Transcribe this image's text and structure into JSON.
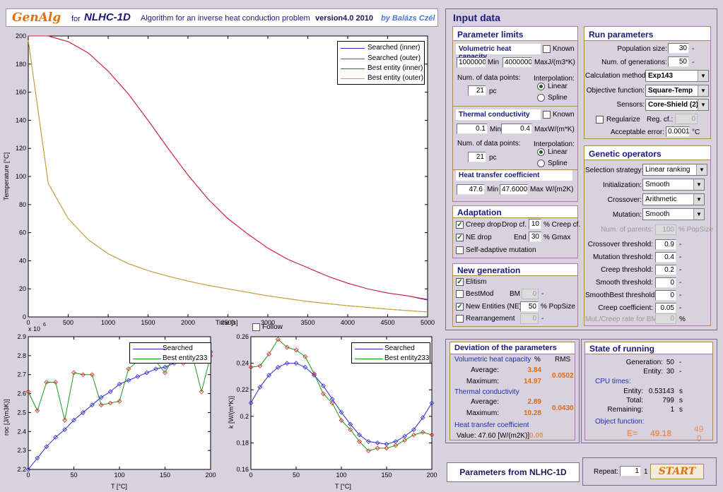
{
  "header": {
    "logo": "GenAlg",
    "for": "for",
    "nlhc": "NLHC-1D",
    "desc": "Algorithm for an inverse heat conduction problem",
    "version": "version4.0  2010",
    "author": "by Balázs Czél"
  },
  "colors": {
    "searched_inner": "#2a2ad0",
    "searched_outer": "#1a9a1a",
    "best_inner": "#e02020",
    "best_outer": "#e09a40"
  },
  "main_plot": {
    "ylabel": "Temperature [°C]",
    "xlabel": "Time [s]",
    "xticks": [
      "0",
      "500",
      "1000",
      "1500",
      "2000",
      "2500",
      "3000",
      "3500",
      "4000",
      "4500",
      "5000"
    ],
    "yticks": [
      "0",
      "20",
      "40",
      "60",
      "80",
      "100",
      "120",
      "140",
      "160",
      "180",
      "200"
    ],
    "legend": [
      "Searched (inner)",
      "Searched (outer)",
      "Best entity (inner)",
      "Best entity (outer)"
    ]
  },
  "follow_label": "Follow",
  "roc_plot": {
    "exponent": "x 10",
    "exp_power": "6",
    "ylabel": "roc [J/(m3K)]",
    "xlabel": "T [°C]",
    "xticks": [
      "0",
      "50",
      "100",
      "150",
      "200"
    ],
    "yticks": [
      "2.2",
      "2.3",
      "2.4",
      "2.5",
      "2.6",
      "2.7",
      "2.8",
      "2.9"
    ],
    "legend": [
      "Searched",
      "Best entity233"
    ]
  },
  "k_plot": {
    "ylabel": "k [W/(m*K)]",
    "xlabel": "T [°C]",
    "xticks": [
      "0",
      "50",
      "100",
      "150",
      "200"
    ],
    "yticks": [
      "0.16",
      "0.18",
      "0.2",
      "0.22",
      "0.24",
      "0.26"
    ],
    "legend": [
      "Searched",
      "Best entity233"
    ]
  },
  "chart_data": [
    {
      "type": "line",
      "xlabel": "Time [s]",
      "ylabel": "Temperature [°C]",
      "xlim": [
        0,
        5000
      ],
      "ylim": [
        0,
        200
      ],
      "x": [
        0,
        250,
        500,
        750,
        1000,
        1250,
        1500,
        1750,
        2000,
        2250,
        2500,
        2750,
        3000,
        3250,
        3500,
        3750,
        4000,
        4250,
        4500,
        4750,
        5000
      ],
      "series": [
        {
          "name": "Searched (inner)",
          "values": [
            200,
            200,
            196,
            188,
            175,
            159,
            140,
            120,
            101,
            84,
            70,
            59,
            49,
            41,
            35,
            29,
            24,
            20,
            17,
            15,
            12
          ]
        },
        {
          "name": "Searched (outer)",
          "values": [
            197,
            95,
            70,
            55,
            45,
            38,
            33,
            29,
            25.5,
            22.5,
            20,
            17.5,
            15,
            13,
            11,
            9.5,
            8,
            6.8,
            5.5,
            4.5,
            3.5
          ]
        },
        {
          "name": "Best entity (inner)",
          "values": [
            200,
            200,
            196,
            188,
            175,
            159,
            140,
            120,
            101,
            84,
            70,
            59,
            49,
            41,
            35,
            29,
            24,
            20,
            17,
            15,
            12.5
          ]
        },
        {
          "name": "Best entity (outer)",
          "values": [
            197,
            95,
            70,
            55,
            45,
            38,
            33,
            29,
            25.5,
            22.5,
            20,
            17.5,
            15,
            13,
            11,
            9.5,
            8,
            6.8,
            5.5,
            4.5,
            3.5
          ]
        }
      ],
      "legend_position": "top-right"
    },
    {
      "type": "line",
      "xlabel": "T [°C]",
      "ylabel": "roc [J/(m3K)]",
      "xlim": [
        0,
        200
      ],
      "ylim": [
        2.2,
        2.9
      ],
      "x": [
        0,
        10,
        20,
        30,
        40,
        50,
        60,
        70,
        80,
        90,
        100,
        110,
        120,
        130,
        140,
        150,
        160,
        170,
        180,
        190,
        200
      ],
      "series": [
        {
          "name": "Searched",
          "values": [
            2.2,
            2.26,
            2.32,
            2.37,
            2.41,
            2.46,
            2.5,
            2.54,
            2.58,
            2.61,
            2.65,
            2.67,
            2.69,
            2.71,
            2.73,
            2.74,
            2.76,
            2.77,
            2.79,
            2.8,
            2.82
          ]
        },
        {
          "name": "Best entity233",
          "values": [
            2.61,
            2.51,
            2.66,
            2.66,
            2.46,
            2.71,
            2.7,
            2.7,
            2.54,
            2.55,
            2.56,
            2.73,
            2.77,
            2.78,
            2.77,
            2.71,
            2.8,
            2.76,
            2.8,
            2.61,
            2.8
          ]
        }
      ],
      "legend_position": "top-right"
    },
    {
      "type": "line",
      "xlabel": "T [°C]",
      "ylabel": "k [W/(m*K)]",
      "xlim": [
        0,
        200
      ],
      "ylim": [
        0.16,
        0.26
      ],
      "x": [
        0,
        10,
        20,
        30,
        40,
        50,
        60,
        70,
        80,
        90,
        100,
        110,
        120,
        130,
        140,
        150,
        160,
        170,
        180,
        190,
        200
      ],
      "series": [
        {
          "name": "Searched",
          "values": [
            0.21,
            0.222,
            0.231,
            0.237,
            0.24,
            0.24,
            0.237,
            0.231,
            0.223,
            0.213,
            0.203,
            0.194,
            0.186,
            0.181,
            0.18,
            0.179,
            0.181,
            0.185,
            0.19,
            0.199,
            0.21
          ]
        },
        {
          "name": "Best entity233",
          "values": [
            0.237,
            0.238,
            0.247,
            0.258,
            0.252,
            0.25,
            0.245,
            0.232,
            0.217,
            0.21,
            0.197,
            0.19,
            0.181,
            0.174,
            0.176,
            0.176,
            0.178,
            0.182,
            0.186,
            0.188,
            0.186
          ]
        }
      ],
      "legend_position": "top-right"
    }
  ],
  "input_data_title": "Input data",
  "param_limits": {
    "title": "Parameter limits",
    "vhc": {
      "title": "Volumetric heat capacity",
      "known": "Known",
      "min_val": "1000000",
      "min_label": "Min",
      "max_val": "4000000",
      "max_label": "Max",
      "unit": "J/(m3*K)",
      "points_label": "Num. of data points:",
      "points_val": "21",
      "pc": "pc",
      "interp": "Interpolation:",
      "linear": "Linear",
      "spline": "Spline"
    },
    "tc": {
      "title": "Thermal conductivity",
      "known": "Known",
      "min_val": "0.1",
      "min_label": "Min",
      "max_val": "0.4",
      "max_label": "Max",
      "unit": "W/(m*K)",
      "points_label": "Num. of data points:",
      "points_val": "21",
      "pc": "pc",
      "interp": "Interpolation:",
      "linear": "Linear",
      "spline": "Spline"
    },
    "htc": {
      "title": "Heat transfer coefficient",
      "min_val": "47.6",
      "min_label": "Min",
      "max_val": "47.60000",
      "max_label": "Max",
      "unit": "W/(m2K)"
    }
  },
  "adaptation": {
    "title": "Adaptation",
    "creep_drop": "Creep drop",
    "drop_cf": "Drop cf.",
    "drop_val": "10",
    "creep_cf": "% Creep cf.",
    "ne_drop": "NE drop",
    "end": "End",
    "end_val": "30",
    "gmax": "% Gmax",
    "self_adaptive": "Self-adaptive mutation"
  },
  "new_generation": {
    "title": "New generation",
    "elitism": "Elitism",
    "bestmod": "BestMod",
    "bm": "BM",
    "bm_val": "0",
    "dash": "-",
    "new_entities": "New Entities (NE)",
    "ne_val": "50",
    "popsize": "% PopSize",
    "rearrangement": "Rearrangement",
    "rearr_val": "0",
    "dash2": "-"
  },
  "run_params": {
    "title": "Run parameters",
    "pop_label": "Population size:",
    "pop_val": "30",
    "pop_unit": "-",
    "gen_label": "Num. of generations:",
    "gen_val": "50",
    "gen_unit": "-",
    "calc_label": "Calculation method:",
    "calc_val": "Exp143",
    "obj_label": "Objective function:",
    "obj_val": "Square-Temp",
    "sens_label": "Sensors:",
    "sens_val": "Core-Shield (2)",
    "regularize": "Regularize",
    "regcf_label": "Reg. cf.:",
    "regcf_val": "0",
    "acc_label": "Acceptable error:",
    "acc_val": "0.0001",
    "acc_unit": "°C"
  },
  "genetic_ops": {
    "title": "Genetic operators",
    "sel_label": "Selection strategy:",
    "sel_val": "Linear ranking",
    "init_label": "Initialization:",
    "init_val": "Smooth",
    "cross_label": "Crossover:",
    "cross_val": "Arithmetic",
    "mut_label": "Mutation:",
    "mut_val": "Smooth",
    "parents_label": "Num. of parents:",
    "parents_val": "100",
    "parents_unit": "% PopSize",
    "rows": [
      {
        "label": "Crossover threshold:",
        "val": "0.9",
        "unit": "-"
      },
      {
        "label": "Mutation threshold:",
        "val": "0.4",
        "unit": "-"
      },
      {
        "label": "Creep threshold:",
        "val": "0.2",
        "unit": "-"
      },
      {
        "label": "Smooth threshold:",
        "val": "0",
        "unit": "-"
      },
      {
        "label": "SmoothBest threshold:",
        "val": "0",
        "unit": "-"
      },
      {
        "label": "Creep coefficient:",
        "val": "0.05",
        "unit": "-"
      }
    ],
    "mutcreep_label": "Mut./Creep rate for BM:",
    "mutcreep_val": "0",
    "mutcreep_unit": "%"
  },
  "deviation": {
    "title": "Deviation of the parameters",
    "vhc": "Volumetric heat capacity",
    "pct": "%",
    "rms": "RMS",
    "avg": "Average:",
    "max": "Maximum:",
    "vhc_avg": "3.84",
    "vhc_max": "14.97",
    "vhc_rms": "0.0502",
    "tc": "Thermal conductivity",
    "tc_avg": "2.89",
    "tc_max": "10.28",
    "tc_rms": "0.0430",
    "htc": "Heat transfer coefficient",
    "value_label": "Value: 47.60 [W/(m2K)]",
    "htc_dev": "0.00"
  },
  "state": {
    "title": "State of running",
    "gen_label": "Generation:",
    "gen_val": "50",
    "gen_unit": "-",
    "ent_label": "Entity:",
    "ent_val": "30",
    "ent_unit": "-",
    "cpu": "CPU times:",
    "cpu_ent_label": "Entity:",
    "cpu_ent_val": "0.53143",
    "cpu_ent_unit": "s",
    "total_label": "Total:",
    "total_val": "799",
    "total_unit": "s",
    "rem_label": "Remaining:",
    "rem_val": "1",
    "rem_unit": "s",
    "obj": "Object function:",
    "e_label": "E=",
    "e_val": "49.18",
    "side1": "49",
    "side2": "0"
  },
  "params_button": "Parameters from NLHC-1D",
  "repeat": {
    "label": "Repeat:",
    "val": "1",
    "count": "1",
    "start": "START"
  }
}
